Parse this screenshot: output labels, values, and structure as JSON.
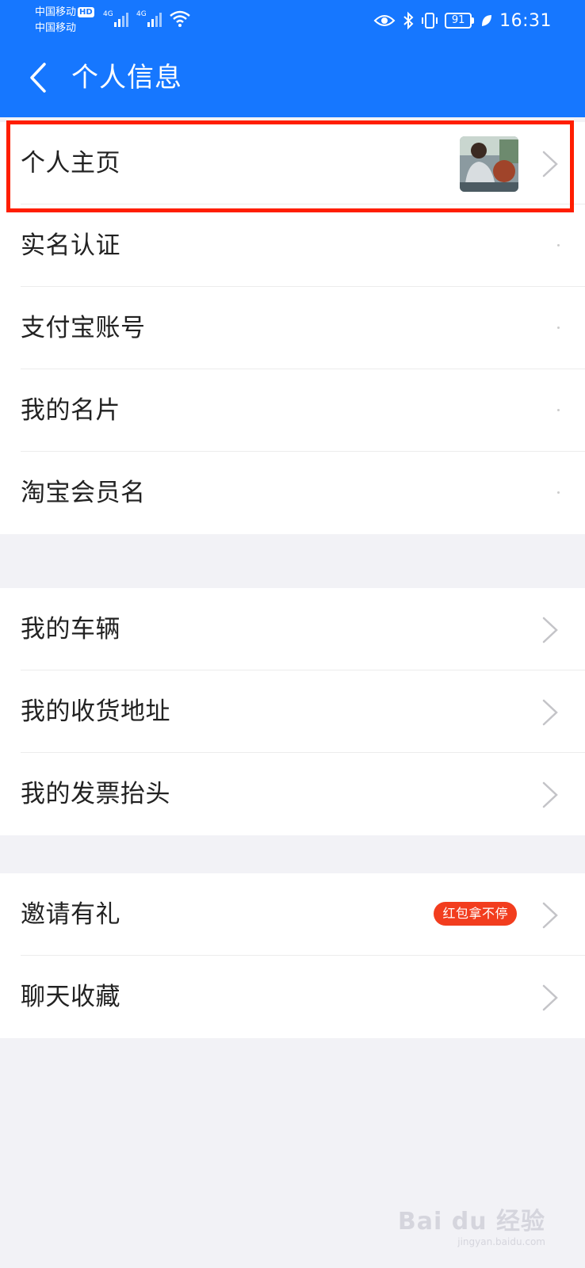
{
  "status_bar": {
    "carrier_1": "中国移动",
    "hd": "HD",
    "carrier_2": "中国移动",
    "network_1": "4G",
    "network_2": "4G",
    "battery": "91",
    "time": "16:31"
  },
  "nav": {
    "title": "个人信息"
  },
  "group_1": {
    "items": [
      {
        "label": "个人主页"
      },
      {
        "label": "实名认证"
      },
      {
        "label": "支付宝账号"
      },
      {
        "label": "我的名片"
      },
      {
        "label": "淘宝会员名"
      }
    ]
  },
  "group_2": {
    "items": [
      {
        "label": "我的车辆"
      },
      {
        "label": "我的收货地址"
      },
      {
        "label": "我的发票抬头"
      }
    ]
  },
  "group_3": {
    "items": [
      {
        "label": "邀请有礼",
        "badge": "红包拿不停"
      },
      {
        "label": "聊天收藏"
      }
    ]
  },
  "watermark": {
    "brand": "Bai du 经验",
    "url": "jingyan.baidu.com"
  },
  "colors": {
    "header_bg": "#1677ff",
    "highlight_border": "#ff1e00",
    "badge_bg": "#f23d1e",
    "page_bg": "#f2f2f6"
  }
}
